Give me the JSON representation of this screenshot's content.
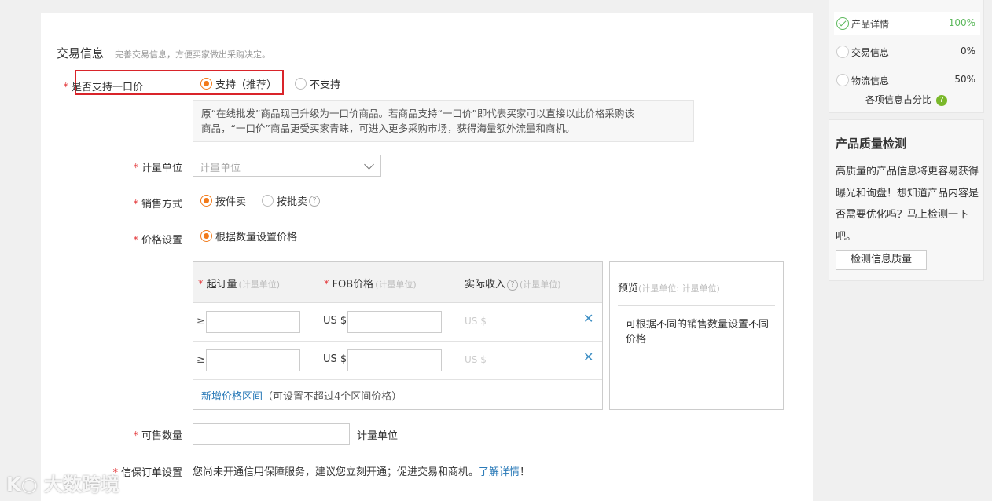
{
  "section": {
    "title": "交易信息",
    "desc": "完善交易信息，方便买家做出采购决定。"
  },
  "one_price": {
    "required_mark": "*",
    "label": "是否支持一口价",
    "option_yes": "支持（推荐）",
    "option_no": "不支持",
    "selected": "yes",
    "notice_line1": "原“在线批发”商品现已升级为一口价商品。若商品支持“一口价”即代表买家可以直接以此价格采购该",
    "notice_line2": "商品，“一口价”商品更受买家青睐，可进入更多采购市场，获得海量额外流量和商机。"
  },
  "unit": {
    "required_mark": "*",
    "label": "计量单位",
    "placeholder": "计量单位"
  },
  "sale_mode": {
    "required_mark": "*",
    "label": "销售方式",
    "option_piece": "按件卖",
    "option_batch": "按批卖",
    "help": "?"
  },
  "price_setting": {
    "required_mark": "*",
    "label": "价格设置",
    "option": "根据数量设置价格",
    "table": {
      "required_mark": "*",
      "col_moq": "起订量",
      "col_moq_sub": "(计量单位)",
      "col_fob": "FOB价格",
      "col_fob_sub": "(计量单位)",
      "col_income": "实际收入",
      "col_income_sub": "(计量单位)",
      "help": "?",
      "rows": [
        {
          "ge": "≥",
          "us_label": "US $",
          "income": "US $",
          "remove": "✕"
        },
        {
          "ge": "≥",
          "us_label": "US $",
          "income": "US $",
          "remove": "✕"
        }
      ],
      "add_link": "新增价格区间",
      "add_note": "（可设置不超过4个区间价格）"
    },
    "preview": {
      "title": "预览",
      "title_sub": "(计量单位: 计量单位)",
      "body": "可根据不同的销售数量设置不同价格"
    }
  },
  "quantity": {
    "required_mark": "*",
    "label": "可售数量",
    "unit": "计量单位"
  },
  "credit": {
    "required_mark": "*",
    "label": "信保订单设置",
    "text": "您尚未开通信用保障服务，建议您立刻开通；促进交易和商机。",
    "link": "了解详情",
    "suffix": "！"
  },
  "progress": {
    "items": [
      {
        "label": "产品详情",
        "value": "100%"
      },
      {
        "label": "交易信息",
        "value": "0%"
      },
      {
        "label": "物流信息",
        "value": "50%"
      }
    ],
    "footer": "各项信息占分比",
    "footer_help": "?"
  },
  "quality": {
    "title": "产品质量检测",
    "body": "高质量的产品信息将更容易获得曝光和询盘！想知道产品内容是否需要优化吗？马上检测一下吧。",
    "button": "检测信息质量"
  },
  "watermark": "大数跨境"
}
